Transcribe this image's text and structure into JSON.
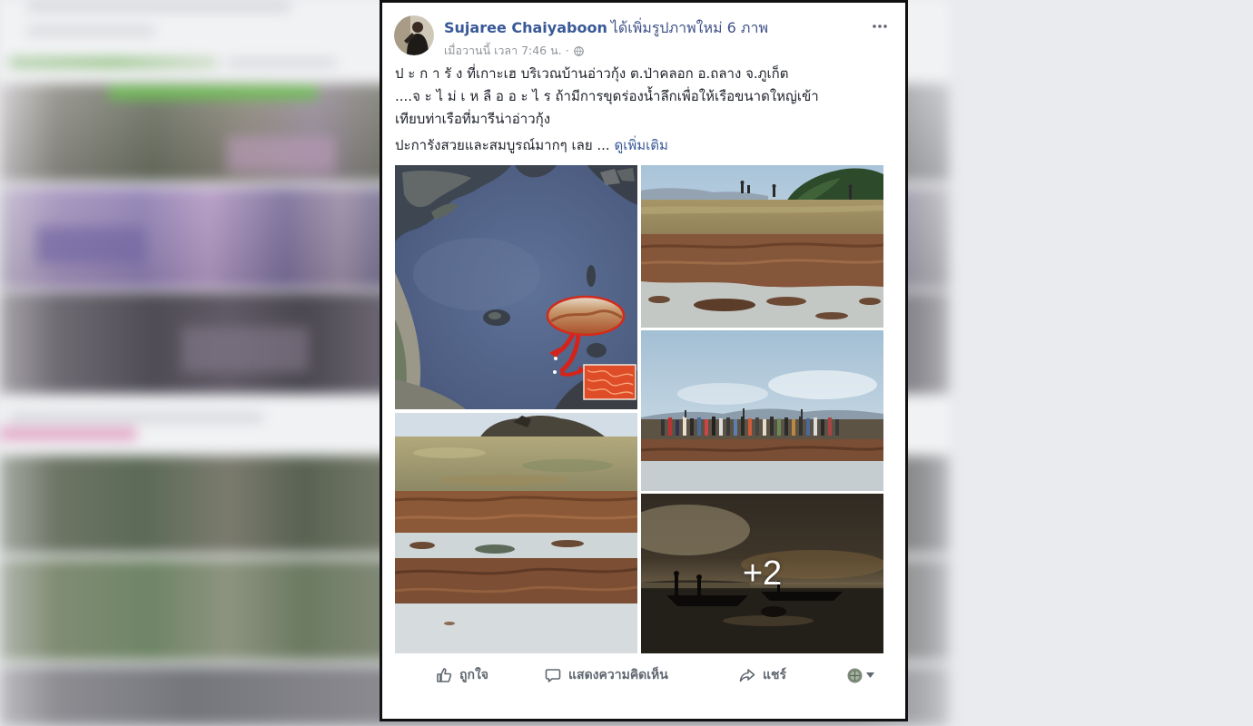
{
  "post": {
    "author_name": "Sujaree Chaiyaboon",
    "author_action": "ได้เพิ่มรูปภาพใหม่ 6 ภาพ",
    "timestamp": "เมื่อวานนี้ เวลา 7:46 น. ·",
    "audience_icon": "globe-icon",
    "menu_icon": "more-options-icon",
    "text_lines": [
      "ป ะ ก า รั ง ที่เกาะเฮ บริเวณบ้านอ่าวกุ้ง ต.ป่าคลอก อ.ถลาง จ.ภูเก็ต",
      "....จ ะ ไ ม่ เ ห ลื อ อ ะ ไ ร ถ้ามีการขุดร่องน้ำลึกเพื่อให้เรือขนาดใหญ่เข้า",
      "เทียบท่าเรือที่มารีน่าอ่าวกุ้ง"
    ],
    "summary": "ปะการังสวยและสมบูรณ์มากๆ เลย ... ",
    "see_more": "ดูเพิ่มเติม",
    "more_photos_overlay": "+2"
  },
  "actions": {
    "like": {
      "label": "ถูกใจ",
      "icon": "like-icon"
    },
    "comment": {
      "label": "แสดงความคิดเห็น",
      "icon": "comment-icon"
    },
    "share": {
      "label": "แชร์",
      "icon": "share-icon"
    },
    "audience_selector": {
      "icon": "page-avatar-icon",
      "caret": "caret-down-icon"
    }
  },
  "colors": {
    "link": "#385898",
    "meta_text": "#90949c",
    "body_text": "#1d2129",
    "action_text": "#606770",
    "card_border": "#111111",
    "page_background": "#e9ebee"
  }
}
